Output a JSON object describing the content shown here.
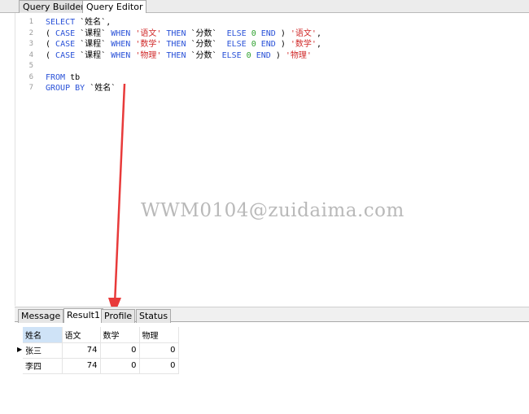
{
  "tabs": [
    {
      "label": "Query Builder",
      "active": false
    },
    {
      "label": "Query Editor",
      "active": true
    }
  ],
  "editor": {
    "line_numbers": [
      "1",
      "2",
      "3",
      "4",
      "5",
      "6",
      "7"
    ],
    "lines": [
      [
        {
          "t": "SELECT ",
          "k": "kw"
        },
        {
          "t": "`姓名`,",
          "k": "id"
        }
      ],
      [
        {
          "t": "( ",
          "k": "id"
        },
        {
          "t": "CASE ",
          "k": "kw"
        },
        {
          "t": "`课程` ",
          "k": "id"
        },
        {
          "t": "WHEN ",
          "k": "kw"
        },
        {
          "t": "'语文' ",
          "k": "str"
        },
        {
          "t": "THEN ",
          "k": "kw"
        },
        {
          "t": "`分数`  ",
          "k": "id"
        },
        {
          "t": "ELSE ",
          "k": "kw"
        },
        {
          "t": "0 ",
          "k": "num"
        },
        {
          "t": "END ",
          "k": "kw"
        },
        {
          "t": ") ",
          "k": "id"
        },
        {
          "t": "'语文'",
          "k": "str"
        },
        {
          "t": ",",
          "k": "id"
        }
      ],
      [
        {
          "t": "( ",
          "k": "id"
        },
        {
          "t": "CASE ",
          "k": "kw"
        },
        {
          "t": "`课程` ",
          "k": "id"
        },
        {
          "t": "WHEN ",
          "k": "kw"
        },
        {
          "t": "'数学' ",
          "k": "str"
        },
        {
          "t": "THEN ",
          "k": "kw"
        },
        {
          "t": "`分数`  ",
          "k": "id"
        },
        {
          "t": "ELSE ",
          "k": "kw"
        },
        {
          "t": "0 ",
          "k": "num"
        },
        {
          "t": "END ",
          "k": "kw"
        },
        {
          "t": ") ",
          "k": "id"
        },
        {
          "t": "'数学'",
          "k": "str"
        },
        {
          "t": ",",
          "k": "id"
        }
      ],
      [
        {
          "t": "( ",
          "k": "id"
        },
        {
          "t": "CASE ",
          "k": "kw"
        },
        {
          "t": "`课程` ",
          "k": "id"
        },
        {
          "t": "WHEN ",
          "k": "kw"
        },
        {
          "t": "'物理' ",
          "k": "str"
        },
        {
          "t": "THEN ",
          "k": "kw"
        },
        {
          "t": "`分数` ",
          "k": "id"
        },
        {
          "t": "ELSE ",
          "k": "kw"
        },
        {
          "t": "0 ",
          "k": "num"
        },
        {
          "t": "END ",
          "k": "kw"
        },
        {
          "t": ") ",
          "k": "id"
        },
        {
          "t": "'物理'",
          "k": "str"
        }
      ],
      [],
      [
        {
          "t": "FROM ",
          "k": "kw"
        },
        {
          "t": "tb",
          "k": "id"
        }
      ],
      [
        {
          "t": "GROUP BY ",
          "k": "kw"
        },
        {
          "t": "`姓名`",
          "k": "id"
        }
      ]
    ],
    "watermark": "WWM0104@zuidaima.com"
  },
  "bottom_tabs": [
    {
      "label": "Message",
      "active": false
    },
    {
      "label": "Result1",
      "active": true
    },
    {
      "label": "Profile",
      "active": false
    },
    {
      "label": "Status",
      "active": false
    }
  ],
  "results": {
    "columns": [
      "姓名",
      "语文",
      "数学",
      "物理"
    ],
    "rows": [
      [
        "张三",
        "74",
        "0",
        "0"
      ],
      [
        "李四",
        "74",
        "0",
        "0"
      ]
    ],
    "current_row_marker": "▶"
  },
  "colors": {
    "keyword": "#2a52d8",
    "string": "#d02a2a",
    "number": "#2ea02e",
    "arrow": "#e83a3a"
  }
}
